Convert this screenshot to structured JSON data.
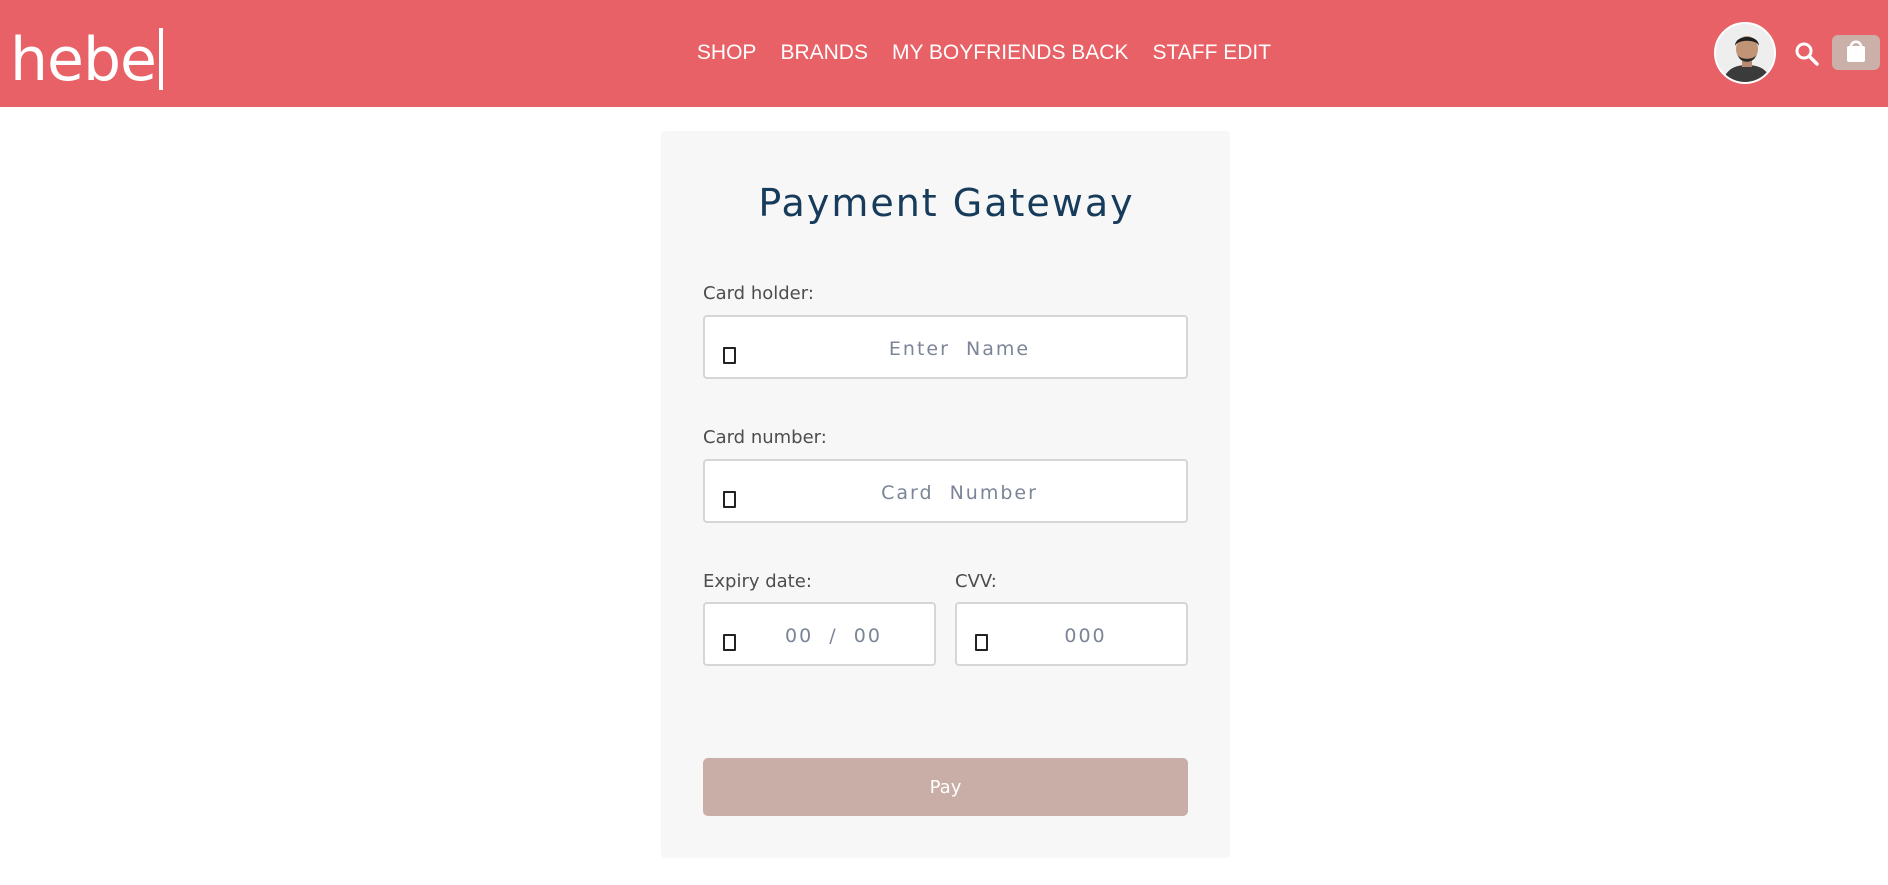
{
  "header": {
    "logo": "hebe",
    "nav": [
      "SHOP",
      "BRANDS",
      "MY BOYFRIENDS BACK",
      "STAFF EDIT"
    ],
    "icons": {
      "avatar": "user-avatar",
      "search": "search-icon",
      "cart": "shopping-bag-icon"
    },
    "colors": {
      "header_bg": "#e86166",
      "cart_bg": "#cbb0aa"
    }
  },
  "payment": {
    "title": "Payment Gateway",
    "card_holder": {
      "label": "Card holder:",
      "placeholder": "Enter  Name",
      "value": ""
    },
    "card_number": {
      "label": "Card number:",
      "placeholder": "Card  Number",
      "value": ""
    },
    "expiry": {
      "label": "Expiry date:",
      "placeholder": "00  /  00",
      "value": ""
    },
    "cvv": {
      "label": "CVV:",
      "placeholder": "000",
      "value": ""
    },
    "pay_button": "Pay",
    "colors": {
      "title": "#173b5b",
      "pay_button_bg": "#c8aea7",
      "card_bg": "#f7f7f7"
    }
  }
}
